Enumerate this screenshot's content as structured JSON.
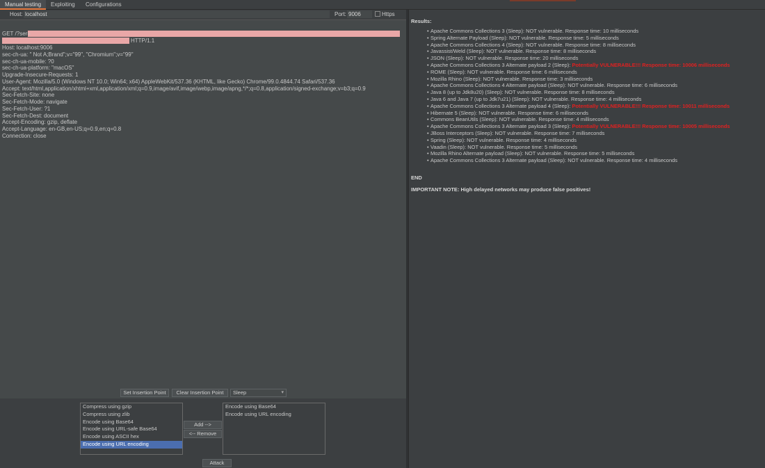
{
  "tabs": [
    {
      "label": "Manual testing",
      "active": true
    },
    {
      "label": "Exploiting",
      "active": false
    },
    {
      "label": "Configurations",
      "active": false
    }
  ],
  "host": {
    "label": "Host:",
    "value": "localhost"
  },
  "port": {
    "label": "Port:",
    "value": "9006"
  },
  "https": {
    "label": "Https",
    "checked": false
  },
  "request": {
    "line1_prefix": "GET /?ser=",
    "line2_suffix": "HTTP/1.1",
    "headers": [
      "Host: localhost:9006",
      "sec-ch-ua: \" Not A;Brand\";v=\"99\", \"Chromium\";v=\"99\"",
      "sec-ch-ua-mobile: ?0",
      "sec-ch-ua-platform: \"macOS\"",
      "Upgrade-Insecure-Requests: 1",
      "User-Agent: Mozilla/5.0 (Windows NT 10.0; Win64; x64) AppleWebKit/537.36 (KHTML, like Gecko) Chrome/99.0.4844.74 Safari/537.36",
      "Accept: text/html,application/xhtml+xml,application/xml;q=0.9,image/avif,image/webp,image/apng,*/*;q=0.8,application/signed-exchange;v=b3;q=0.9",
      "Sec-Fetch-Site: none",
      "Sec-Fetch-Mode: navigate",
      "Sec-Fetch-User: ?1",
      "Sec-Fetch-Dest: document",
      "Accept-Encoding: gzip, deflate",
      "Accept-Language: en-GB,en-US;q=0.9,en;q=0.8",
      "Connection: close"
    ]
  },
  "controls": {
    "set_insertion_point": "Set Insertion Point",
    "clear_insertion_point": "Clear Insertion Point",
    "payload_type": "Sleep",
    "add": "Add -->",
    "remove": "<-- Remove",
    "attack": "Attack"
  },
  "available_encodings": [
    {
      "label": "Compress using gzip",
      "selected": false
    },
    {
      "label": "Compress using zlib",
      "selected": false
    },
    {
      "label": "Encode using Base64",
      "selected": false
    },
    {
      "label": "Encode using URL-safe Base64",
      "selected": false
    },
    {
      "label": "Encode using ASCII hex",
      "selected": false
    },
    {
      "label": "Encode using URL encoding",
      "selected": true
    }
  ],
  "applied_encodings": [
    "Encode using Base64",
    "Encode using URL encoding"
  ],
  "results": {
    "title": "Results:",
    "items": [
      {
        "text": "Apache Commons Collections 3 (Sleep): NOT vulnerable. Response time: 10 milliseconds",
        "vuln": ""
      },
      {
        "text": "Spring Alternate Payload (Sleep): NOT vulnerable. Response time: 5 milliseconds",
        "vuln": ""
      },
      {
        "text": "Apache Commons Collections 4 (Sleep): NOT vulnerable. Response time: 8 milliseconds",
        "vuln": ""
      },
      {
        "text": "Javassist/Weld (Sleep): NOT vulnerable. Response time: 8 milliseconds",
        "vuln": ""
      },
      {
        "text": "JSON (Sleep): NOT vulnerable. Response time: 20 milliseconds",
        "vuln": ""
      },
      {
        "text": "Apache Commons Collections 3 Alternate payload 2 (Sleep): ",
        "vuln": "Potentially VULNERABLE!!! Response time: 10006 milliseconds"
      },
      {
        "text": "ROME (Sleep): NOT vulnerable. Response time: 6 milliseconds",
        "vuln": ""
      },
      {
        "text": "Mozilla Rhino (Sleep): NOT vulnerable. Response time: 3 milliseconds",
        "vuln": ""
      },
      {
        "text": "Apache Commons Collections 4 Alternate payload (Sleep): NOT vulnerable. Response time: 6 milliseconds",
        "vuln": ""
      },
      {
        "text": "Java 8 (up to Jdk8u20) (Sleep): NOT vulnerable. Response time: 8 milliseconds",
        "vuln": ""
      },
      {
        "text": "Java 6 and Java 7 (up to Jdk7u21) (Sleep): NOT vulnerable. Response time: 4 milliseconds",
        "vuln": ""
      },
      {
        "text": "Apache Commons Collections 3 Alternate payload 4 (Sleep): ",
        "vuln": "Potentially VULNERABLE!!! Response time: 10011 milliseconds"
      },
      {
        "text": "Hibernate 5 (Sleep): NOT vulnerable. Response time: 6 milliseconds",
        "vuln": ""
      },
      {
        "text": "Commons BeanUtils (Sleep): NOT vulnerable. Response time: 4 milliseconds",
        "vuln": ""
      },
      {
        "text": "Apache Commons Collections 3 Alternate payload 3 (Sleep): ",
        "vuln": "Potentially VULNERABLE!!! Response time: 10005 milliseconds"
      },
      {
        "text": "JBoss Interceptors (Sleep): NOT vulnerable. Response time: 7 milliseconds",
        "vuln": ""
      },
      {
        "text": "Spring (Sleep): NOT vulnerable. Response time: 4 milliseconds",
        "vuln": ""
      },
      {
        "text": "Vaadin (Sleep): NOT vulnerable. Response time: 5 milliseconds",
        "vuln": ""
      },
      {
        "text": "Mozilla Rhino Alternate payload (Sleep): NOT vulnerable. Response time: 5 milliseconds",
        "vuln": ""
      },
      {
        "text": "Apache Commons Collections 3 Alternate payload (Sleep): NOT vulnerable. Response time: 4 milliseconds",
        "vuln": ""
      }
    ],
    "end": "END",
    "note": "IMPORTANT NOTE: High delayed networks may produce false positives!"
  }
}
